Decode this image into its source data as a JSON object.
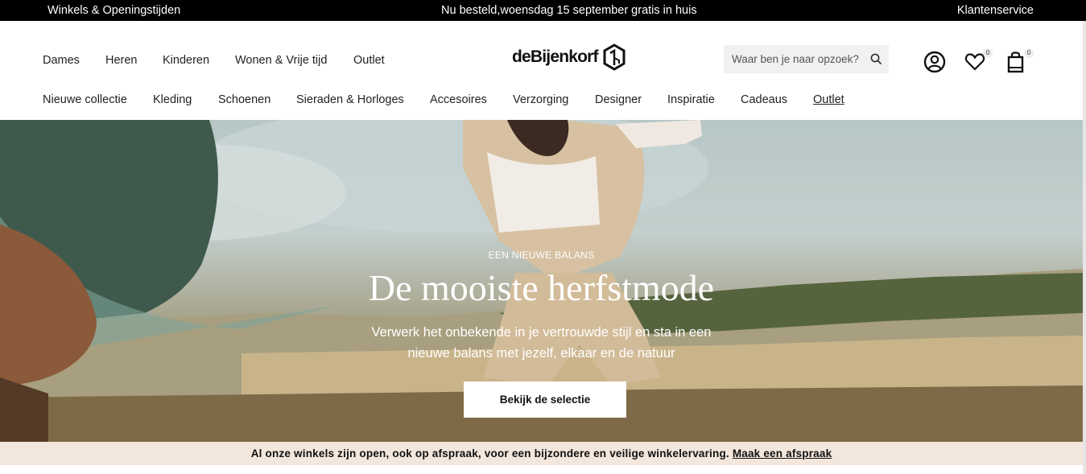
{
  "topbar": {
    "stores": "Winkels & Openingstijden",
    "promo": "Nu besteld,woensdag 15 september gratis in huis",
    "service": "Klantenservice"
  },
  "logo": {
    "text": "deBijenkorf"
  },
  "primary_nav": [
    "Dames",
    "Heren",
    "Kinderen",
    "Wonen & Vrije tijd",
    "Outlet"
  ],
  "secondary_nav": [
    "Nieuwe collectie",
    "Kleding",
    "Schoenen",
    "Sieraden & Horloges",
    "Accesoires",
    "Verzorging",
    "Designer",
    "Inspiratie",
    "Cadeaus",
    "Outlet"
  ],
  "search": {
    "placeholder": "Waar ben je naar opzoek?",
    "icon": "search-icon"
  },
  "icons": {
    "account": "user-circle-icon",
    "wishlist": "heart-icon",
    "wishlist_count": "0",
    "bag": "shopping-bag-icon",
    "bag_count": "0"
  },
  "hero": {
    "eyebrow": "EEN NIEUWE BALANS",
    "title": "De mooiste herfstmode",
    "text": "Verwerk het onbekende in je vertrouwde stijl en sta in een nieuwe balans met jezelf, elkaar en de natuur",
    "button": "Bekijk de selectie"
  },
  "notice": {
    "text": "Al onze winkels zijn open, ook op afspraak, voor een bijzondere en veilige winkelervaring.",
    "link": "Maak een afspraak"
  },
  "colors": {
    "topbar": "#000000",
    "notice_bg": "#f3e6dc",
    "search_bg": "#f1f1f1"
  }
}
